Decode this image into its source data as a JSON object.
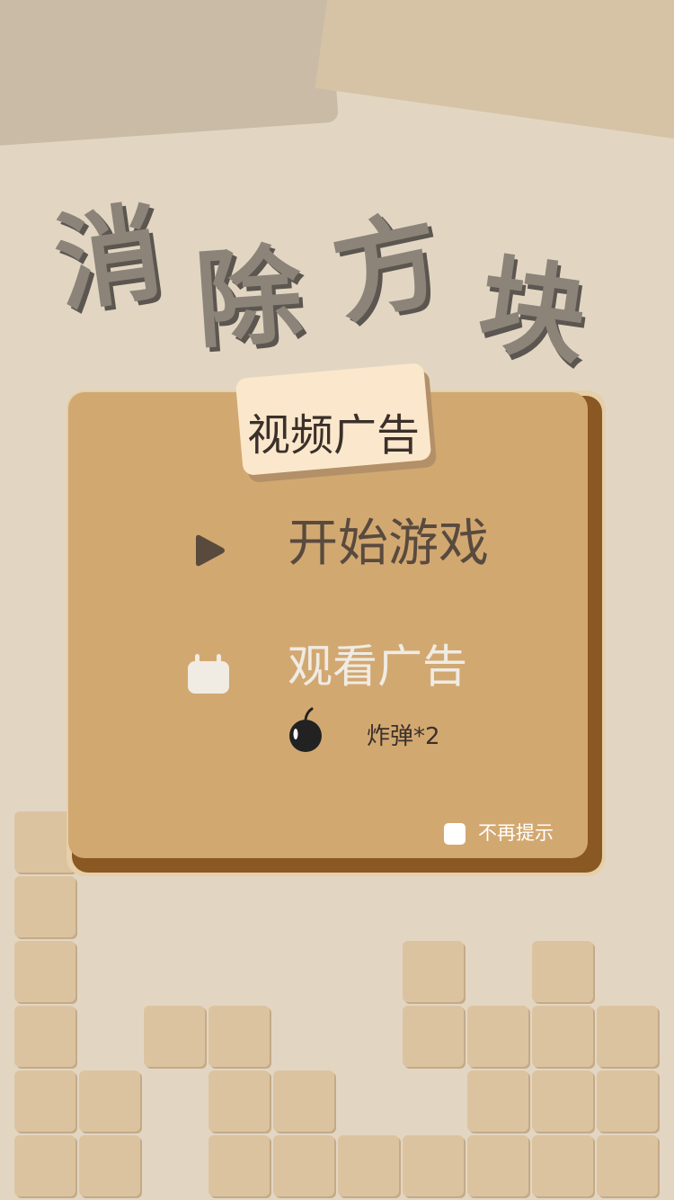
{
  "title": {
    "chars": [
      "消",
      "除",
      "方",
      "块"
    ]
  },
  "dialog": {
    "tag_label": "视频广告",
    "start_button_label": "开始游戏",
    "watch_ad_label": "观看广告",
    "reward_label": "炸弹*2",
    "dont_show_label": "不再提示",
    "dont_show_checked": false
  },
  "icons": {
    "play": "play-icon",
    "tv": "tv-icon",
    "bomb": "bomb-icon",
    "checkbox": "checkbox-icon"
  },
  "colors": {
    "background": "#e2d6c3",
    "card": "#d2a871",
    "card_shadow": "#8a5822",
    "tag": "#fbe8cc",
    "tile": "#dcc3a0",
    "title": "#8c8479"
  }
}
